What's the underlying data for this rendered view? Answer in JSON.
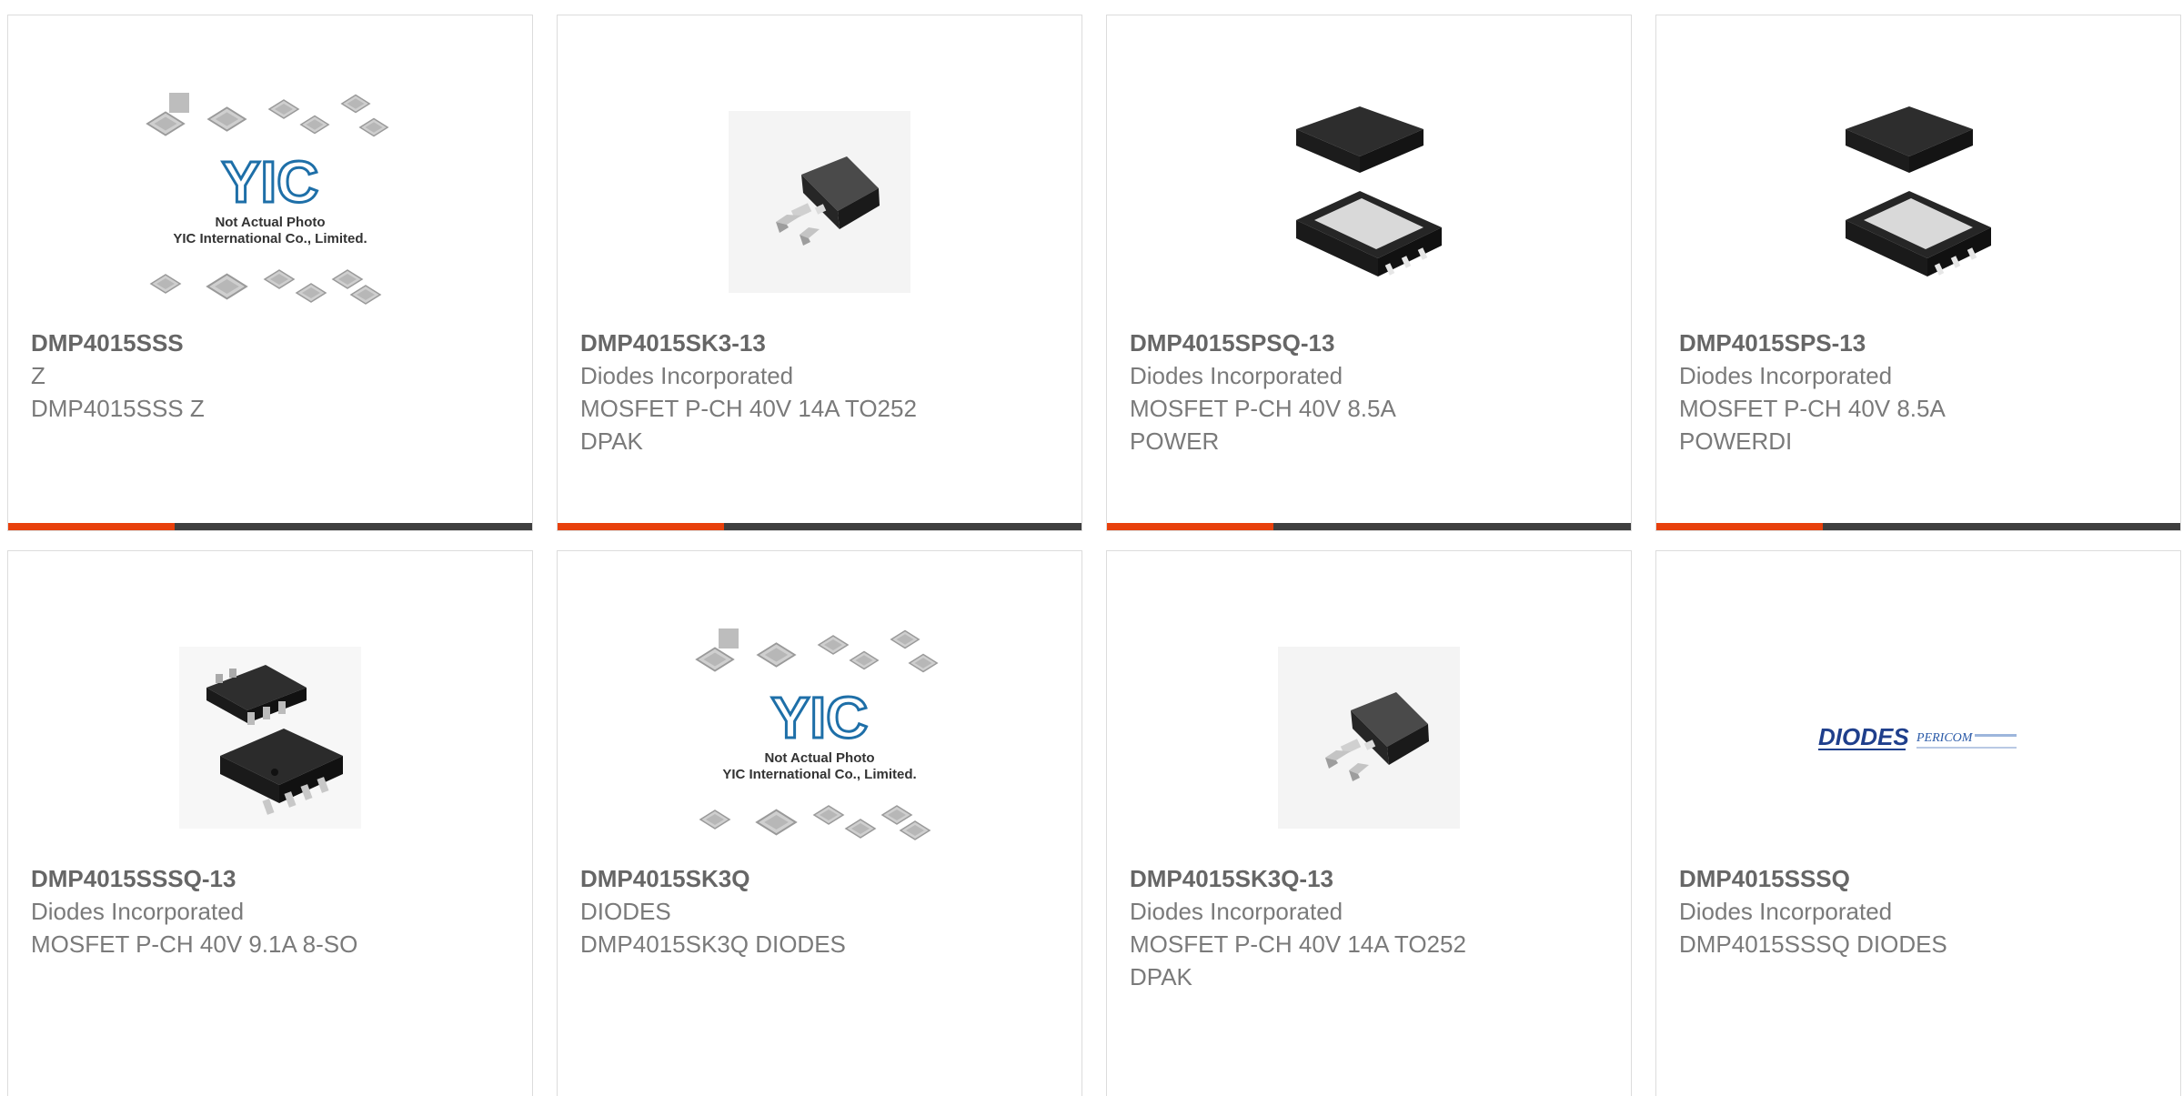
{
  "colors": {
    "accent_bar": "#e8400c",
    "dark_bar": "#3f3f3f",
    "card_border": "#dcdcdc",
    "title_text": "#666666",
    "body_text": "#7a7a7a"
  },
  "placeholder_image": {
    "brand": "YIC",
    "caption_line1": "Not Actual Photo",
    "caption_line2": "YIC International Co., Limited."
  },
  "diodes_logo": {
    "brand": "DIODES",
    "sub_brand": "PERICOM"
  },
  "products": [
    {
      "part_number": "DMP4015SSS",
      "manufacturer": "Z",
      "description": "DMP4015SSS Z",
      "image": "placeholder-photo"
    },
    {
      "part_number": "DMP4015SK3-13",
      "manufacturer": "Diodes Incorporated",
      "description": "MOSFET P-CH 40V 14A TO252\nDPAK",
      "image": "to252-package"
    },
    {
      "part_number": "DMP4015SPSQ-13",
      "manufacturer": "Diodes Incorporated",
      "description": "MOSFET P-CH 40V 8.5A\nPOWER",
      "image": "powerdi-package"
    },
    {
      "part_number": "DMP4015SPS-13",
      "manufacturer": "Diodes Incorporated",
      "description": "MOSFET P-CH 40V 8.5A\nPOWERDI",
      "image": "powerdi-package"
    },
    {
      "part_number": "DMP4015SSSQ-13",
      "manufacturer": "Diodes Incorporated",
      "description": "MOSFET P-CH 40V 9.1A 8-SO",
      "image": "so8-package"
    },
    {
      "part_number": "DMP4015SK3Q",
      "manufacturer": "DIODES",
      "description": "DMP4015SK3Q DIODES",
      "image": "placeholder-photo"
    },
    {
      "part_number": "DMP4015SK3Q-13",
      "manufacturer": "Diodes Incorporated",
      "description": "MOSFET P-CH 40V 14A TO252\nDPAK",
      "image": "to252-package"
    },
    {
      "part_number": "DMP4015SSSQ",
      "manufacturer": "Diodes Incorporated",
      "description": "DMP4015SSSQ DIODES",
      "image": "diodes-logo"
    }
  ]
}
